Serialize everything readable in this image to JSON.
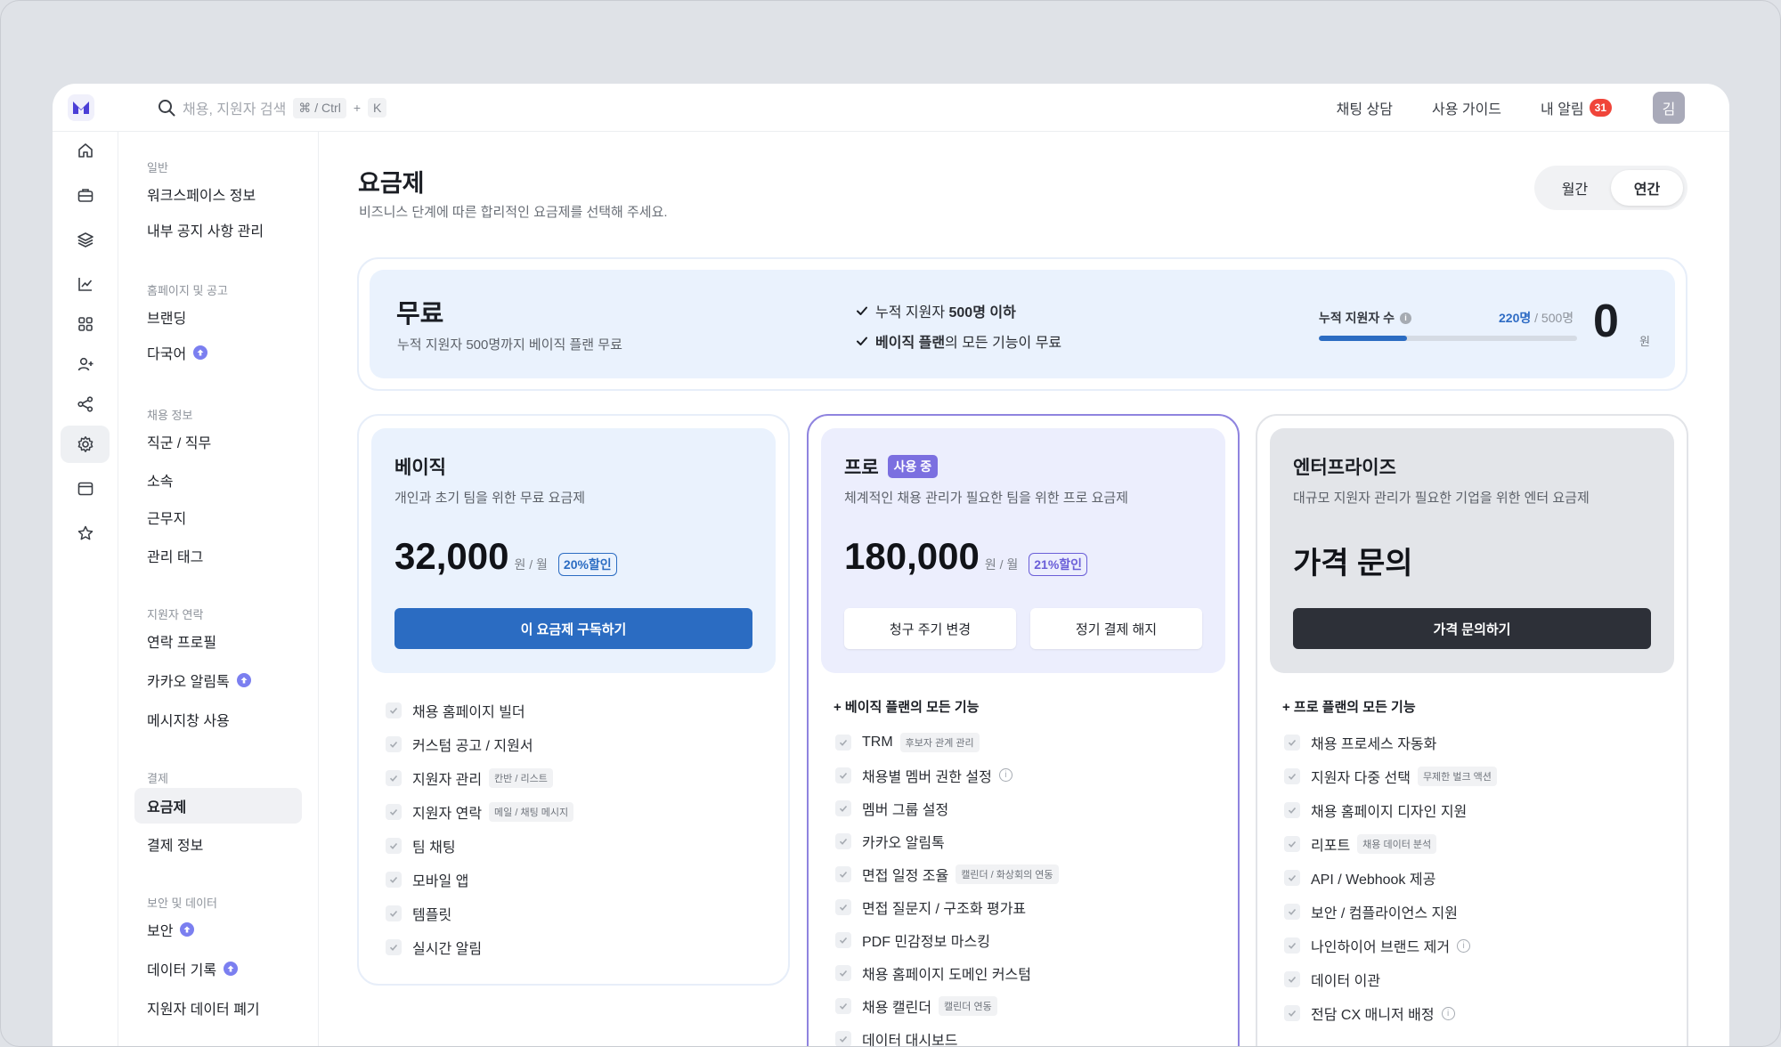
{
  "colors": {
    "accent_blue": "#2b6cc2",
    "accent_purple": "#7b6fe0",
    "dark": "#2d3038",
    "badge_red": "#f0453a"
  },
  "topbar": {
    "search_placeholder": "채용, 지원자 검색",
    "shortcut_1": "⌘ / Ctrl",
    "shortcut_plus": "+",
    "shortcut_2": "K",
    "links": [
      "채팅 상담",
      "사용 가이드",
      "내 알림"
    ],
    "notif_count": "31",
    "avatar": "김"
  },
  "rail": {
    "icons": [
      "home-icon",
      "briefcase-icon",
      "layers-icon",
      "chart-icon",
      "grid-icon",
      "user-add-icon",
      "share-icon",
      "gear-icon",
      "window-icon",
      "star-icon"
    ],
    "active": "gear-icon"
  },
  "sidebar": {
    "groups": [
      {
        "title": "일반",
        "items": [
          "워크스페이스 정보",
          "내부 공지 사항 관리"
        ]
      },
      {
        "title": "홈페이지 및 공고",
        "items": [
          "브랜딩",
          "다국어"
        ]
      },
      {
        "title": "채용 정보",
        "items": [
          "직군 / 직무",
          "소속",
          "근무지",
          "관리 태그"
        ]
      },
      {
        "title": "지원자 연락",
        "items": [
          "연락 프로필",
          "카카오 알림톡",
          "메시지창 사용"
        ]
      },
      {
        "title": "결제",
        "items": [
          "요금제",
          "결제 정보"
        ]
      },
      {
        "title": "보안 및 데이터",
        "items": [
          "보안",
          "데이터 기록",
          "지원자 데이터 폐기"
        ]
      }
    ],
    "active_item": "요금제"
  },
  "main": {
    "title": "요금제",
    "subtitle": "비즈니스 단계에 따른 합리적인 요금제를 선택해 주세요.",
    "billing_toggle": {
      "monthly": "월간",
      "yearly": "연간",
      "selected": "yearly"
    }
  },
  "free_plan": {
    "name": "무료",
    "desc": "누적 지원자 500명까지 베이직 플랜 무료",
    "check_1_pre": "누적 지원자 ",
    "check_1_bold": "500명 이하",
    "check_2_bold": "베이직 플랜",
    "check_2_post": "의 모든 기능이 무료",
    "applicants_label": "누적 지원자 수",
    "applicants_current": "220명",
    "applicants_limit": "/ 500명",
    "applicants_progress": 0.34,
    "price": "0",
    "price_unit": "원"
  },
  "plans": [
    {
      "key": "basic",
      "name": "베이직",
      "desc": "개인과 초기 팀을 위한 무료 요금제",
      "price": "32,000",
      "per": "원 / 월",
      "discount": "20%할인",
      "cta": "이 요금제 구독하기",
      "features_head": "",
      "features": [
        {
          "label": "채용 홈페이지 빌더"
        },
        {
          "label": "커스텀 공고 / 지원서"
        },
        {
          "label": "지원자 관리",
          "tag": "칸반 / 리스트"
        },
        {
          "label": "지원자 연락",
          "tag": "메일 / 채팅 메시지"
        },
        {
          "label": "팀 채팅"
        },
        {
          "label": "모바일 앱"
        },
        {
          "label": "템플릿"
        },
        {
          "label": "실시간 알림"
        }
      ]
    },
    {
      "key": "pro",
      "name": "프로",
      "badge": "사용 중",
      "desc": "체계적인 채용 관리가 필요한 팀을 위한 프로 요금제",
      "price": "180,000",
      "per": "원 / 월",
      "discount": "21%할인",
      "btn_1": "청구 주기 변경",
      "btn_2": "정기 결제 해지",
      "features_head": "+ 베이직 플랜의 모든 기능",
      "features": [
        {
          "label": "TRM",
          "tag": "후보자 관계 관리"
        },
        {
          "label": "채용별 멤버 권한 설정",
          "info": "i"
        },
        {
          "label": "멤버 그룹 설정"
        },
        {
          "label": "카카오 알림톡"
        },
        {
          "label": "면접 일정 조율",
          "tag": "캘린더 / 화상회의 연동"
        },
        {
          "label": "면접 질문지 / 구조화 평가표"
        },
        {
          "label": "PDF 민감정보 마스킹"
        },
        {
          "label": "채용 홈페이지 도메인 커스텀"
        },
        {
          "label": "채용 캘린더",
          "tag": "캘린더 연동"
        },
        {
          "label": "데이터 대시보드"
        }
      ]
    },
    {
      "key": "enterprise",
      "name": "엔터프라이즈",
      "desc": "대규모 지원자 관리가 필요한 기업을 위한 엔터 요금제",
      "price_text": "가격 문의",
      "cta": "가격 문의하기",
      "features_head": "+ 프로 플랜의 모든 기능",
      "features": [
        {
          "label": "채용 프로세스 자동화"
        },
        {
          "label": "지원자 다중 선택",
          "tag": "무제한 벌크 액션"
        },
        {
          "label": "채용 홈페이지 디자인 지원"
        },
        {
          "label": "리포트",
          "tag": "채용 데이터 분석"
        },
        {
          "label": "API / Webhook 제공"
        },
        {
          "label": "보안 / 컴플라이언스 지원"
        },
        {
          "label": "나인하이어 브랜드 제거",
          "info": "i"
        },
        {
          "label": "데이터 이관"
        },
        {
          "label": "전담 CX 매니저 배정",
          "info": "i"
        }
      ]
    }
  ]
}
